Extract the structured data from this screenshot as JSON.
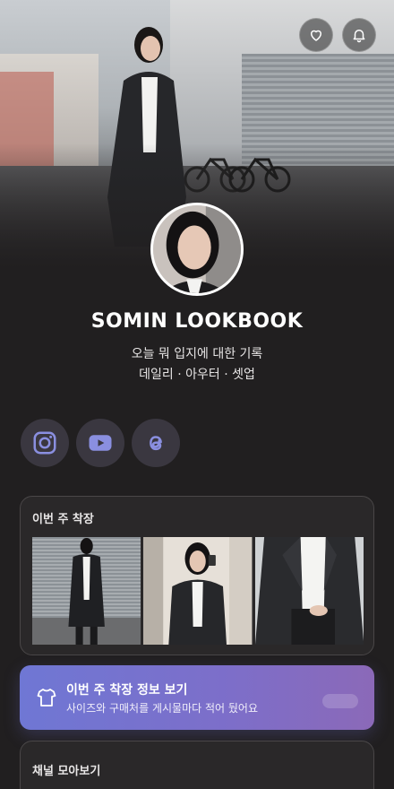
{
  "header": {
    "favorite_icon": "heart-icon",
    "notification_icon": "bell-icon"
  },
  "profile": {
    "name": "SOMIN LOOKBOOK",
    "bio_line1": "오늘 뭐 입지에 대한 기록",
    "bio_line2": "데일리 · 아우터 · 셋업"
  },
  "social_links": [
    {
      "icon": "instagram-icon"
    },
    {
      "icon": "youtube-icon"
    },
    {
      "icon": "threads-icon"
    }
  ],
  "weekly_outfit": {
    "title": "이번 주 착장"
  },
  "cta": {
    "icon": "tshirt-icon",
    "title": "이번 주 착장 정보 보기",
    "subtitle": "사이즈와 구매처를 게시물마다 적어 뒀어요"
  },
  "channels": {
    "title": "채널 모아보기"
  },
  "colors": {
    "background": "#211f20",
    "card": "#2a2829",
    "accent_start": "#6f77d4",
    "accent_end": "#8b69b8",
    "icon_tint": "#8a8fe0"
  }
}
